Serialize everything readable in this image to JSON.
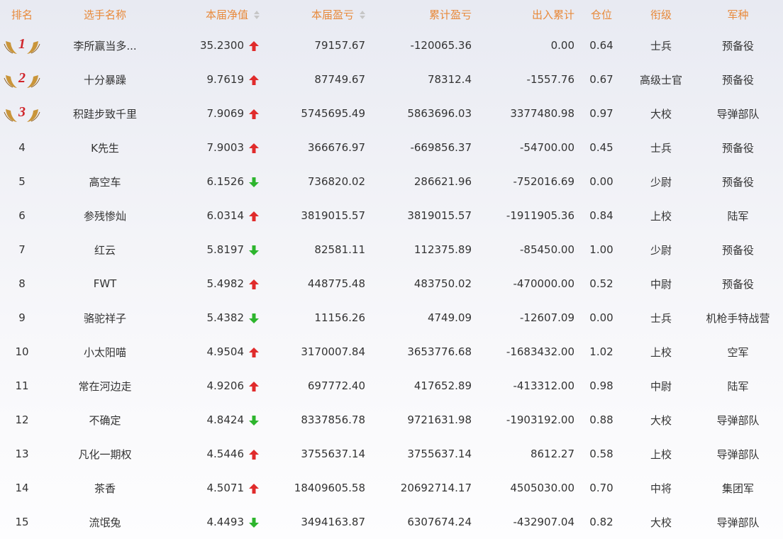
{
  "header": {
    "rank": "排名",
    "name": "选手名称",
    "nav": "本届净值",
    "pl": "本届盈亏",
    "cum_pl": "累计盈亏",
    "inout": "出入累计",
    "position": "仓位",
    "title": "衔级",
    "army": "军种"
  },
  "colors": {
    "header_text": "#e8893a",
    "up": "#e02b2b",
    "down": "#2db52d",
    "medal_gold": "#c9953a",
    "medal_number": "#d0252b"
  },
  "rows": [
    {
      "rank": "1",
      "medal": "1",
      "name": "李所赢当多...",
      "nav": "35.2300",
      "dir": "up",
      "pl": "79157.67",
      "cum": "-120065.36",
      "io": "0.00",
      "pos": "0.64",
      "title": "士兵",
      "army": "预备役"
    },
    {
      "rank": "2",
      "medal": "2",
      "name": "十分暴躁",
      "nav": "9.7619",
      "dir": "up",
      "pl": "87749.67",
      "cum": "78312.4",
      "io": "-1557.76",
      "pos": "0.67",
      "title": "高级士官",
      "army": "预备役"
    },
    {
      "rank": "3",
      "medal": "3",
      "name": "积跬步致千里",
      "nav": "7.9069",
      "dir": "up",
      "pl": "5745695.49",
      "cum": "5863696.03",
      "io": "3377480.98",
      "pos": "0.97",
      "title": "大校",
      "army": "导弹部队"
    },
    {
      "rank": "4",
      "name": "K先生",
      "nav": "7.9003",
      "dir": "up",
      "pl": "366676.97",
      "cum": "-669856.37",
      "io": "-54700.00",
      "pos": "0.45",
      "title": "士兵",
      "army": "预备役"
    },
    {
      "rank": "5",
      "name": "高空车",
      "nav": "6.1526",
      "dir": "down",
      "pl": "736820.02",
      "cum": "286621.96",
      "io": "-752016.69",
      "pos": "0.00",
      "title": "少尉",
      "army": "预备役"
    },
    {
      "rank": "6",
      "name": "参残惨灿",
      "nav": "6.0314",
      "dir": "up",
      "pl": "3819015.57",
      "cum": "3819015.57",
      "io": "-1911905.36",
      "pos": "0.84",
      "title": "上校",
      "army": "陆军"
    },
    {
      "rank": "7",
      "name": "红云",
      "nav": "5.8197",
      "dir": "down",
      "pl": "82581.11",
      "cum": "112375.89",
      "io": "-85450.00",
      "pos": "1.00",
      "title": "少尉",
      "army": "预备役"
    },
    {
      "rank": "8",
      "name": "FWT",
      "nav": "5.4982",
      "dir": "up",
      "pl": "448775.48",
      "cum": "483750.02",
      "io": "-470000.00",
      "pos": "0.52",
      "title": "中尉",
      "army": "预备役"
    },
    {
      "rank": "9",
      "name": "骆驼祥子",
      "nav": "5.4382",
      "dir": "down",
      "pl": "11156.26",
      "cum": "4749.09",
      "io": "-12607.09",
      "pos": "0.00",
      "title": "士兵",
      "army": "机枪手特战营"
    },
    {
      "rank": "10",
      "name": "小太阳喵",
      "nav": "4.9504",
      "dir": "up",
      "pl": "3170007.84",
      "cum": "3653776.68",
      "io": "-1683432.00",
      "pos": "1.02",
      "title": "上校",
      "army": "空军"
    },
    {
      "rank": "11",
      "name": "常在河边走",
      "nav": "4.9206",
      "dir": "up",
      "pl": "697772.40",
      "cum": "417652.89",
      "io": "-413312.00",
      "pos": "0.98",
      "title": "中尉",
      "army": "陆军"
    },
    {
      "rank": "12",
      "name": "不确定",
      "nav": "4.8424",
      "dir": "down",
      "pl": "8337856.78",
      "cum": "9721631.98",
      "io": "-1903192.00",
      "pos": "0.88",
      "title": "大校",
      "army": "导弹部队"
    },
    {
      "rank": "13",
      "name": "凡化一期权",
      "nav": "4.5446",
      "dir": "up",
      "pl": "3755637.14",
      "cum": "3755637.14",
      "io": "8612.27",
      "pos": "0.58",
      "title": "上校",
      "army": "导弹部队"
    },
    {
      "rank": "14",
      "name": "茶香",
      "nav": "4.5071",
      "dir": "up",
      "pl": "18409605.58",
      "cum": "20692714.17",
      "io": "4505030.00",
      "pos": "0.70",
      "title": "中将",
      "army": "集团军"
    },
    {
      "rank": "15",
      "name": "流氓兔",
      "nav": "4.4493",
      "dir": "down",
      "pl": "3494163.87",
      "cum": "6307674.24",
      "io": "-432907.04",
      "pos": "0.82",
      "title": "大校",
      "army": "导弹部队"
    }
  ]
}
